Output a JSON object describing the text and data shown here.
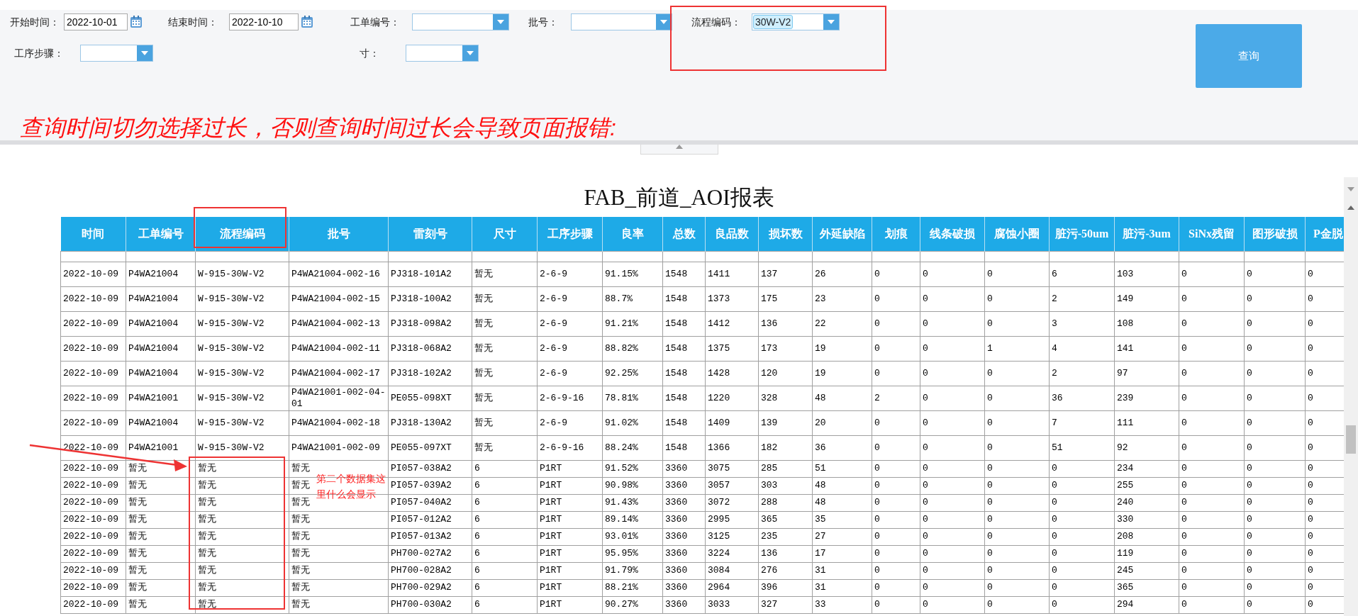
{
  "filters": [
    {
      "kind": "date",
      "label": "开始时间：",
      "value": "2022-10-01"
    },
    {
      "kind": "date",
      "label": "结束时间：",
      "value": "2022-10-10"
    },
    {
      "kind": "select",
      "label": "工单编号："
    },
    {
      "kind": "select",
      "label": "批号："
    },
    {
      "kind": "select",
      "label": "流程编码：",
      "value": "30W-V2"
    },
    {
      "kind": "select",
      "label": "工序步骤："
    },
    {
      "kind": "select",
      "label": "寸："
    }
  ],
  "query_button": "查询",
  "warning": "查询时间切勿选择过长，否则查询时间过长会导致页面报错:",
  "report": {
    "title": "FAB_前道_AOI报表",
    "columns": [
      "时间",
      "工单编号",
      "流程编码",
      "批号",
      "雷刻号",
      "尺寸",
      "工序步骤",
      "良率",
      "总数",
      "良品数",
      "损坏数",
      "外延缺陷",
      "划痕",
      "线条破损",
      "腐蚀小圈",
      "脏污-50um",
      "脏污-3um",
      "SiNx残留",
      "图形破损",
      "P金脱"
    ],
    "rows": [
      {
        "kind": "tall",
        "cells": [
          "2022-10-09",
          "P4WA21004",
          "W-915-30W-V2",
          "P4WA21004-002-16",
          "PJ318-101A2",
          "暂无",
          "2-6-9",
          "91.15%",
          "1548",
          "1411",
          "137",
          "26",
          "0",
          "0",
          "0",
          "6",
          "103",
          "0",
          "0",
          "0"
        ]
      },
      {
        "kind": "tall",
        "cells": [
          "2022-10-09",
          "P4WA21004",
          "W-915-30W-V2",
          "P4WA21004-002-15",
          "PJ318-100A2",
          "暂无",
          "2-6-9",
          "88.7%",
          "1548",
          "1373",
          "175",
          "23",
          "0",
          "0",
          "0",
          "2",
          "149",
          "0",
          "0",
          "0"
        ]
      },
      {
        "kind": "tall",
        "cells": [
          "2022-10-09",
          "P4WA21004",
          "W-915-30W-V2",
          "P4WA21004-002-13",
          "PJ318-098A2",
          "暂无",
          "2-6-9",
          "91.21%",
          "1548",
          "1412",
          "136",
          "22",
          "0",
          "0",
          "0",
          "3",
          "108",
          "0",
          "0",
          "0"
        ]
      },
      {
        "kind": "tall",
        "cells": [
          "2022-10-09",
          "P4WA21004",
          "W-915-30W-V2",
          "P4WA21004-002-11",
          "PJ318-068A2",
          "暂无",
          "2-6-9",
          "88.82%",
          "1548",
          "1375",
          "173",
          "19",
          "0",
          "0",
          "1",
          "4",
          "141",
          "0",
          "0",
          "0"
        ]
      },
      {
        "kind": "tall",
        "cells": [
          "2022-10-09",
          "P4WA21004",
          "W-915-30W-V2",
          "P4WA21004-002-17",
          "PJ318-102A2",
          "暂无",
          "2-6-9",
          "92.25%",
          "1548",
          "1428",
          "120",
          "19",
          "0",
          "0",
          "0",
          "2",
          "97",
          "0",
          "0",
          "0"
        ]
      },
      {
        "kind": "tall",
        "cells": [
          "2022-10-09",
          "P4WA21001",
          "W-915-30W-V2",
          "P4WA21001-002-04-01",
          "PE055-098XT",
          "暂无",
          "2-6-9-16",
          "78.81%",
          "1548",
          "1220",
          "328",
          "48",
          "2",
          "0",
          "0",
          "36",
          "239",
          "0",
          "0",
          "0"
        ]
      },
      {
        "kind": "tall",
        "cells": [
          "2022-10-09",
          "P4WA21004",
          "W-915-30W-V2",
          "P4WA21004-002-18",
          "PJ318-130A2",
          "暂无",
          "2-6-9",
          "91.02%",
          "1548",
          "1409",
          "139",
          "20",
          "0",
          "0",
          "0",
          "7",
          "111",
          "0",
          "0",
          "0"
        ]
      },
      {
        "kind": "tall",
        "cells": [
          "2022-10-09",
          "P4WA21001",
          "W-915-30W-V2",
          "P4WA21001-002-09",
          "PE055-097XT",
          "暂无",
          "2-6-9-16",
          "88.24%",
          "1548",
          "1366",
          "182",
          "36",
          "0",
          "0",
          "0",
          "51",
          "92",
          "0",
          "0",
          "0"
        ]
      },
      {
        "kind": "compact",
        "cells": [
          "2022-10-09",
          "暂无",
          "暂无",
          "暂无",
          "PI057-038A2",
          "6",
          "P1RT",
          "91.52%",
          "3360",
          "3075",
          "285",
          "51",
          "0",
          "0",
          "0",
          "0",
          "234",
          "0",
          "0",
          "0"
        ]
      },
      {
        "kind": "compact",
        "cells": [
          "2022-10-09",
          "暂无",
          "暂无",
          "暂无",
          "PI057-039A2",
          "6",
          "P1RT",
          "90.98%",
          "3360",
          "3057",
          "303",
          "48",
          "0",
          "0",
          "0",
          "0",
          "255",
          "0",
          "0",
          "0"
        ]
      },
      {
        "kind": "compact",
        "cells": [
          "2022-10-09",
          "暂无",
          "暂无",
          "暂无",
          "PI057-040A2",
          "6",
          "P1RT",
          "91.43%",
          "3360",
          "3072",
          "288",
          "48",
          "0",
          "0",
          "0",
          "0",
          "240",
          "0",
          "0",
          "0"
        ]
      },
      {
        "kind": "compact",
        "cells": [
          "2022-10-09",
          "暂无",
          "暂无",
          "暂无",
          "PI057-012A2",
          "6",
          "P1RT",
          "89.14%",
          "3360",
          "2995",
          "365",
          "35",
          "0",
          "0",
          "0",
          "0",
          "330",
          "0",
          "0",
          "0"
        ]
      },
      {
        "kind": "compact",
        "cells": [
          "2022-10-09",
          "暂无",
          "暂无",
          "暂无",
          "PI057-013A2",
          "6",
          "P1RT",
          "93.01%",
          "3360",
          "3125",
          "235",
          "27",
          "0",
          "0",
          "0",
          "0",
          "208",
          "0",
          "0",
          "0"
        ]
      },
      {
        "kind": "compact",
        "cells": [
          "2022-10-09",
          "暂无",
          "暂无",
          "暂无",
          "PH700-027A2",
          "6",
          "P1RT",
          "95.95%",
          "3360",
          "3224",
          "136",
          "17",
          "0",
          "0",
          "0",
          "0",
          "119",
          "0",
          "0",
          "0"
        ]
      },
      {
        "kind": "compact",
        "cells": [
          "2022-10-09",
          "暂无",
          "暂无",
          "暂无",
          "PH700-028A2",
          "6",
          "P1RT",
          "91.79%",
          "3360",
          "3084",
          "276",
          "31",
          "0",
          "0",
          "0",
          "0",
          "245",
          "0",
          "0",
          "0"
        ]
      },
      {
        "kind": "compact",
        "cells": [
          "2022-10-09",
          "暂无",
          "暂无",
          "暂无",
          "PH700-029A2",
          "6",
          "P1RT",
          "88.21%",
          "3360",
          "2964",
          "396",
          "31",
          "0",
          "0",
          "0",
          "0",
          "365",
          "0",
          "0",
          "0"
        ]
      },
      {
        "kind": "compact",
        "cells": [
          "2022-10-09",
          "暂无",
          "暂无",
          "暂无",
          "PH700-030A2",
          "6",
          "P1RT",
          "90.27%",
          "3360",
          "3033",
          "327",
          "33",
          "0",
          "0",
          "0",
          "0",
          "294",
          "0",
          "0",
          "0"
        ]
      }
    ]
  },
  "annotations": [
    {
      "kind": "box"
    },
    {
      "kind": "box"
    },
    {
      "kind": "box"
    },
    {
      "kind": "arrow"
    },
    {
      "kind": "note",
      "text": "第二个数据集这里什么会显示"
    }
  ]
}
